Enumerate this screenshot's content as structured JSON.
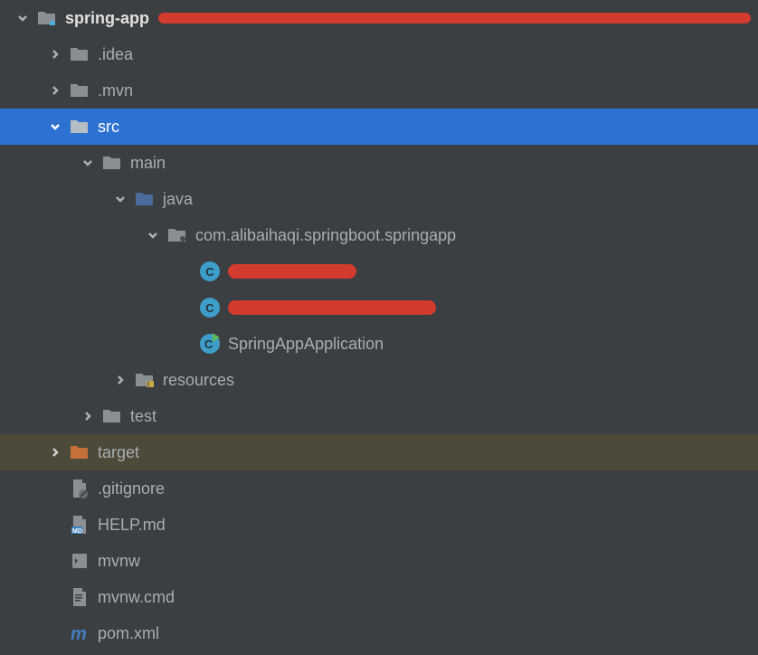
{
  "tree": {
    "root": {
      "label": "spring-app"
    },
    "idea": {
      "label": ".idea"
    },
    "mvn": {
      "label": ".mvn"
    },
    "src": {
      "label": "src"
    },
    "main": {
      "label": "main"
    },
    "java": {
      "label": "java"
    },
    "package": {
      "label": "com.alibaihaqi.springboot.springapp"
    },
    "spring_app_class": {
      "label": "SpringAppApplication"
    },
    "resources": {
      "label": "resources"
    },
    "test": {
      "label": "test"
    },
    "target": {
      "label": "target"
    },
    "gitignore": {
      "label": ".gitignore"
    },
    "help": {
      "label": "HELP.md"
    },
    "mvnw": {
      "label": "mvnw"
    },
    "mvnw_cmd": {
      "label": "mvnw.cmd"
    },
    "pom": {
      "label": "pom.xml"
    }
  }
}
